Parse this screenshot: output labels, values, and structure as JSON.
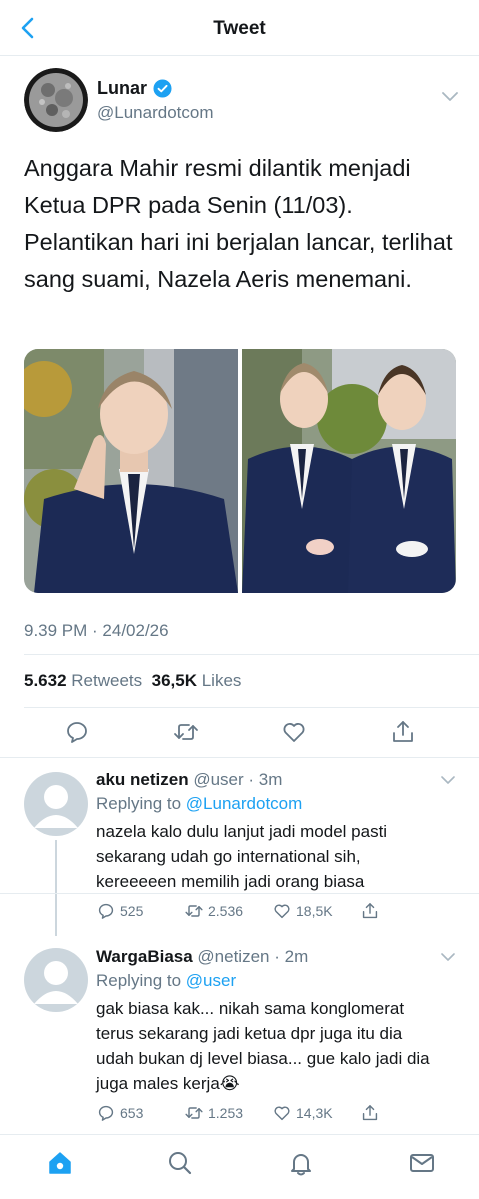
{
  "header": {
    "title": "Tweet",
    "back_icon": "chevron-left-icon"
  },
  "colors": {
    "accent": "#1da1f2",
    "muted": "#657786",
    "text": "#14171a",
    "divider": "#e6ecf0"
  },
  "tweet": {
    "author": {
      "name": "Lunar",
      "handle": "@Lunardotcom",
      "verified": true
    },
    "text": "Anggara Mahir resmi dilantik menjadi Ketua DPR pada Senin (11/03). Pelantikan hari ini berjalan lancar, terlihat sang suami, Nazela Aeris menemani.",
    "timestamp": "9.39 PM · 24/02/26",
    "stats": {
      "retweets_count": "5.632",
      "retweets_label": "Retweets",
      "likes_count": "36,5K",
      "likes_label": "Likes"
    },
    "actions": [
      "reply-icon",
      "retweet-icon",
      "like-icon",
      "share-icon"
    ]
  },
  "replies": [
    {
      "name": "aku netizen",
      "handle": "@user",
      "time": "· 3m",
      "replying_label": "Replying to",
      "replying_to": "@Lunardotcom",
      "text": "nazela kalo dulu lanjut jadi model pasti sekarang udah go international sih, kereeeeen memilih jadi orang biasa",
      "reply_count": "525",
      "retweet_count": "2.536",
      "like_count": "18,5K"
    },
    {
      "name": "WargaBiasa",
      "handle": "@netizen",
      "time": "· 2m",
      "replying_label": "Replying to",
      "replying_to": "@user",
      "text": "gak biasa kak... nikah sama konglomerat terus sekarang jadi ketua dpr juga itu dia udah bukan dj level biasa... gue kalo jadi dia juga males kerja😭",
      "reply_count": "653",
      "retweet_count": "1.253",
      "like_count": "14,3K"
    }
  ],
  "tabbar": {
    "items": [
      "home-icon",
      "search-icon",
      "notifications-icon",
      "messages-icon"
    ]
  }
}
